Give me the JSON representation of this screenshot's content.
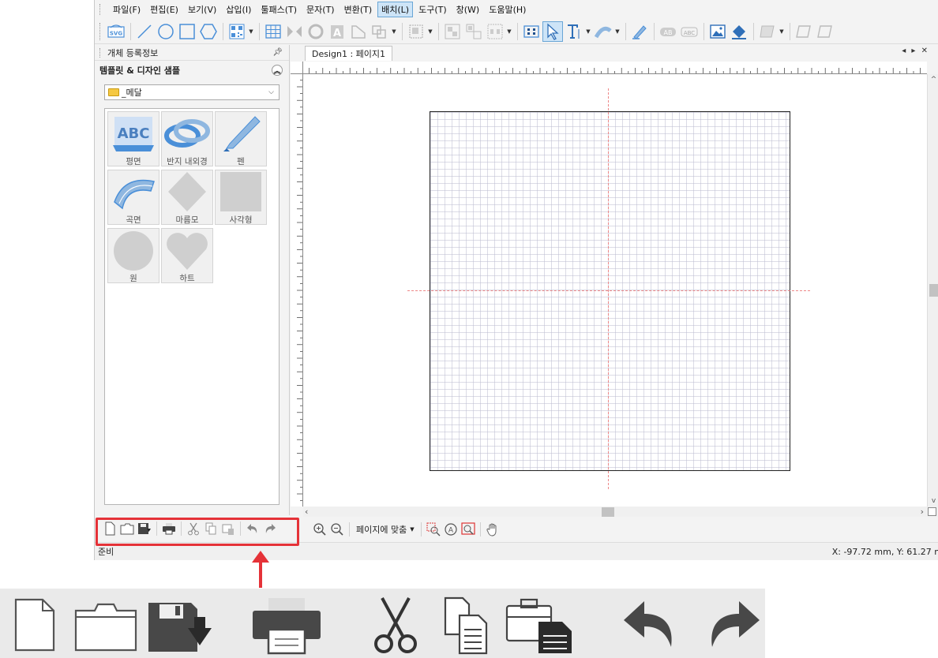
{
  "menu": {
    "items": [
      {
        "label": "파일(F)"
      },
      {
        "label": "편집(E)"
      },
      {
        "label": "보기(V)"
      },
      {
        "label": "삽입(I)"
      },
      {
        "label": "툴패스(T)"
      },
      {
        "label": "문자(T)"
      },
      {
        "label": "변환(T)"
      },
      {
        "label": "배치(L)",
        "active": true
      },
      {
        "label": "도구(T)"
      },
      {
        "label": "창(W)"
      },
      {
        "label": "도움말(H)"
      }
    ]
  },
  "toolbar": {
    "svg_badge": "SVG"
  },
  "left_panel": {
    "header_title": "개체 등록정보",
    "pin_icon": "pin-icon",
    "section_title": "템플릿 & 디자인 샘플",
    "category_value": "_메달",
    "samples": [
      {
        "label": "평면",
        "icon": "flat-abc-icon"
      },
      {
        "label": "반지 내외경",
        "icon": "ring-icon"
      },
      {
        "label": "펜",
        "icon": "pen-icon"
      },
      {
        "label": "곡면",
        "icon": "curved-surface-icon"
      },
      {
        "label": "마름모",
        "icon": "diamond-icon"
      },
      {
        "label": "사각형",
        "icon": "square-icon"
      },
      {
        "label": "원",
        "icon": "circle-icon"
      },
      {
        "label": "하트",
        "icon": "heart-icon"
      }
    ],
    "flat_thumb_text": "ABC"
  },
  "document": {
    "tab_title": "Design1 : 페이지1",
    "tab_controls": "◂ ▸ ✕",
    "zoom_fit_label": "페이지에 맞춤"
  },
  "status": {
    "left_text": "준비",
    "coords": "X: -97.72 mm,  Y: 61.27 m"
  },
  "colors": {
    "highlight": "#e53238",
    "selected_menu": "#cde4f7",
    "accent_blue": "#4a8fd8"
  }
}
